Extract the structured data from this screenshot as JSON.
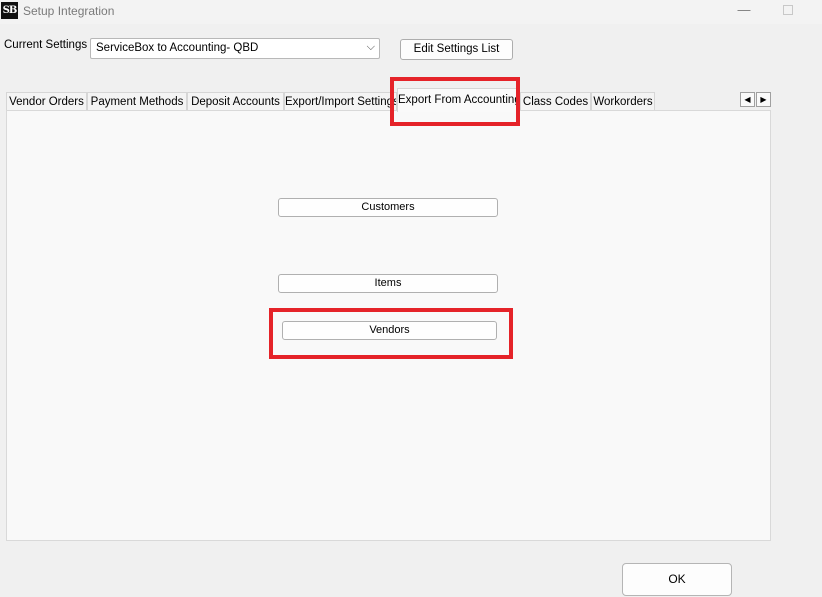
{
  "window": {
    "title": "Setup Integration",
    "icon_text": "SB"
  },
  "settings": {
    "label": "Current Settings",
    "selected": "ServiceBox to Accounting- QBD",
    "edit_button": "Edit Settings List"
  },
  "tabs": [
    {
      "label": "Vendor Orders",
      "active": false
    },
    {
      "label": "Payment Methods",
      "active": false
    },
    {
      "label": "Deposit Accounts",
      "active": false
    },
    {
      "label": "Export/Import Settings",
      "active": false
    },
    {
      "label": "Export From Accounting",
      "active": true
    },
    {
      "label": "Class Codes",
      "active": false
    },
    {
      "label": "Workorders",
      "active": false
    }
  ],
  "tab_scroll": {
    "left": "◀",
    "right": "▶"
  },
  "panel": {
    "customers_button": "Customers",
    "items_button": "Items",
    "vendors_button": "Vendors"
  },
  "footer": {
    "ok_button": "OK"
  },
  "colors": {
    "highlight": "#e52329"
  },
  "icons": {
    "minimize": "—",
    "chevron": "⌵"
  }
}
